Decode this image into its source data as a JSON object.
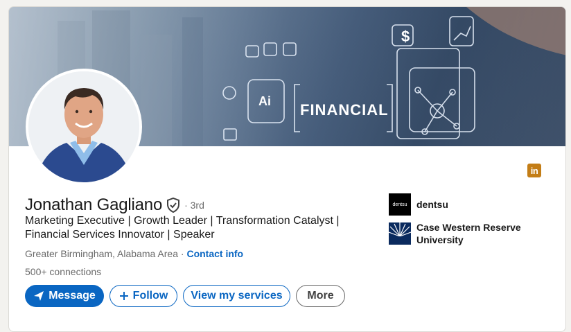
{
  "banner": {
    "banner_text": "FINANCIAL",
    "chip_label": "Ai"
  },
  "profile": {
    "name": "Jonathan Gagliano",
    "degree": "· 3rd",
    "headline": "Marketing Executive | Growth Leader | Transformation Catalyst | Financial Services Innovator | Speaker",
    "location": "Greater Birmingham, Alabama Area",
    "location_sep": " · ",
    "contact_info": "Contact info",
    "connections": "500+ connections"
  },
  "actions": {
    "message": "Message",
    "follow": "Follow",
    "services": "View my services",
    "more": "More"
  },
  "experience": [
    {
      "label": "dentsu",
      "logo_text": "dentsu"
    },
    {
      "label": "Case Western Reserve University",
      "logo_text": ""
    }
  ],
  "badge": {
    "text": "in"
  },
  "colors": {
    "primary": "#0a66c2",
    "badge": "#c37d16",
    "text_secondary": "rgba(0,0,0,0.6)"
  },
  "icons": [
    "verified-shield-icon",
    "send-icon",
    "plus-icon",
    "linkedin-icon"
  ]
}
